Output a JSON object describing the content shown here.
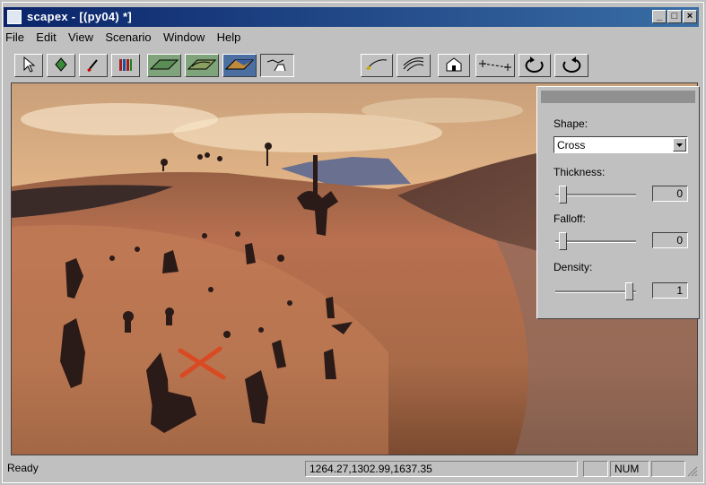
{
  "window": {
    "title": "scapex - [(py04) *]",
    "controls": [
      "_",
      "□",
      "×"
    ]
  },
  "menu": [
    "File",
    "Edit",
    "View",
    "Scenario",
    "Window",
    "Help"
  ],
  "toolbar": {
    "buttons": [
      "select-arrow-icon",
      "diamond-icon",
      "brush-icon",
      "books-icon",
      "terrain-flat-icon",
      "terrain-hills-icon",
      "terrain-textured-icon",
      "place-unit-icon",
      "path-icon",
      "waves-icon",
      "building-icon",
      "waypoint-icon",
      "rotate-cw-icon",
      "rotate-ccw-icon"
    ]
  },
  "brush_panel": {
    "shape_label": "Shape:",
    "shape_value": "Cross",
    "thickness_label": "Thickness:",
    "thickness_value": "0",
    "falloff_label": "Falloff:",
    "falloff_value": "0",
    "density_label": "Density:",
    "density_value": "1"
  },
  "status": {
    "ready": "Ready",
    "coords": "1264.27,1302.99,1637.35",
    "num": "NUM"
  },
  "colors": {
    "titlebar": "#0a246a",
    "chrome": "#c0c0c0",
    "brush_marker": "#e0431b"
  }
}
